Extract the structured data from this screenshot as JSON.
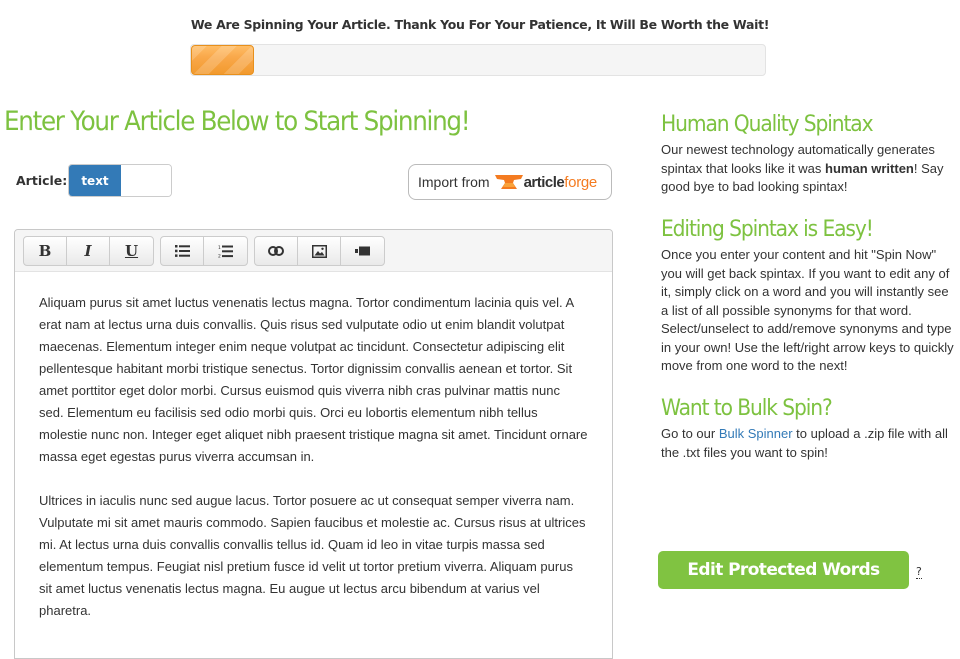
{
  "status": {
    "message": "We Are Spinning Your Article. Thank You For Your Patience, It Will Be Worth the Wait!",
    "progress_percent": 11,
    "progress_color": "#f7a43a"
  },
  "main": {
    "title": "Enter Your Article Below to Start Spinning!",
    "article_label": "Article:",
    "toggle": {
      "active_option": "text"
    },
    "import_button": {
      "label": "Import from",
      "brand_part1": "article",
      "brand_part2": "forge"
    },
    "toolbar": {
      "groups": [
        [
          {
            "name": "bold",
            "glyph": "B"
          },
          {
            "name": "italic",
            "glyph": "I"
          },
          {
            "name": "underline",
            "glyph": "U"
          }
        ],
        [
          {
            "name": "bullet-list"
          },
          {
            "name": "numbered-list"
          }
        ],
        [
          {
            "name": "link"
          },
          {
            "name": "image"
          },
          {
            "name": "video"
          }
        ]
      ]
    },
    "paragraphs": [
      "Aliquam purus sit amet luctus venenatis lectus magna. Tortor condimentum lacinia quis vel. A erat nam at lectus urna duis convallis. Quis risus sed vulputate odio ut enim blandit volutpat maecenas. Elementum integer enim neque volutpat ac tincidunt. Consectetur adipiscing elit pellentesque habitant morbi tristique senectus. Tortor dignissim convallis aenean et tortor. Sit amet porttitor eget dolor morbi. Cursus euismod quis viverra nibh cras pulvinar mattis nunc sed. Elementum eu facilisis sed odio morbi quis. Orci eu lobortis elementum nibh tellus molestie nunc non. Integer eget aliquet nibh praesent tristique magna sit amet. Tincidunt ornare massa eget egestas purus viverra accumsan in.",
      "Ultrices in iaculis nunc sed augue lacus. Tortor posuere ac ut consequat semper viverra nam. Vulputate mi sit amet mauris commodo. Sapien faucibus et molestie ac. Cursus risus at ultrices mi. At lectus urna duis convallis convallis tellus id. Quam id leo in vitae turpis massa sed elementum tempus. Feugiat nisl pretium fusce id velit ut tortor pretium viverra. Aliquam purus sit amet luctus venenatis lectus magna. Eu augue ut lectus arcu bibendum at varius vel pharetra."
    ]
  },
  "sidebar": {
    "sections": [
      {
        "title": "Human Quality Spintax",
        "text_before": "Our newest technology automatically generates spintax that looks like it was ",
        "bold": "human written",
        "text_after": "! Say good bye to bad looking spintax!"
      },
      {
        "title": "Editing Spintax is Easy!",
        "text": "Once you enter your content and hit \"Spin Now\" you will get back spintax. If you want to edit any of it, simply click on a word and you will instantly see a list of all possible synonyms for that word. Select/unselect to add/remove synonyms and type in your own! Use the left/right arrow keys to quickly move from one word to the next!"
      },
      {
        "title": "Want to Bulk Spin?",
        "text_before": "Go to our ",
        "link": "Bulk Spinner",
        "text_after": " to upload a .zip file with all the .txt files you want to spin!"
      }
    ],
    "protect_button": "Edit Protected Words",
    "help_mark": "?"
  },
  "colors": {
    "accent_green": "#7dc240",
    "toggle_blue": "#337ab7",
    "link_blue": "#337ab7",
    "brand_orange": "#f47b20"
  }
}
